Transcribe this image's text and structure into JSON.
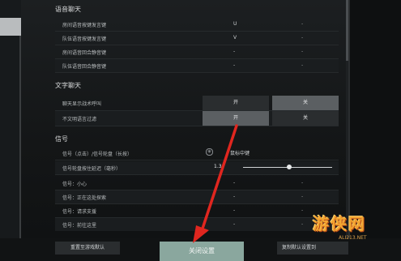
{
  "sections": {
    "voice": "语音聊天",
    "text": "文字聊天",
    "signal": "信号"
  },
  "voice_rows": [
    {
      "label": "房间语音按键发言键",
      "value": "U",
      "alt": "-"
    },
    {
      "label": "队伍语音按键发言键",
      "value": "V",
      "alt": "-"
    },
    {
      "label": "房间语音回合静音键",
      "value": "-",
      "alt": "-"
    },
    {
      "label": "队伍语音回合静音键",
      "value": "-",
      "alt": "-"
    }
  ],
  "text_rows": [
    {
      "label": "聊天显示战术呼叫",
      "on": "开",
      "off": "关",
      "selected": "off"
    },
    {
      "label": "不文明语言过滤",
      "on": "开",
      "off": "关",
      "selected": "on"
    }
  ],
  "signal_rows": [
    {
      "label": "信号（点击）/信号轮盘（长按）",
      "value": "鼠标中键",
      "alt": ""
    },
    {
      "label": "信号轮盘按住延迟（毫秒）",
      "value": "1.3",
      "alt": ""
    },
    {
      "label": "信号：小心",
      "value": "-",
      "alt": "-"
    },
    {
      "label": "信号：正在这处探索",
      "value": "-",
      "alt": "-"
    },
    {
      "label": "信号：请求支援",
      "value": "-",
      "alt": "-"
    },
    {
      "label": "信号：前往这里",
      "value": "-",
      "alt": "-"
    }
  ],
  "slider": {
    "value": 0.5
  },
  "footer": {
    "reset": "重置至游戏默认",
    "close": "关闭设置",
    "apply": "复制默认设置到"
  },
  "watermark": {
    "text": "游侠网",
    "url": "ALI213.NET"
  }
}
